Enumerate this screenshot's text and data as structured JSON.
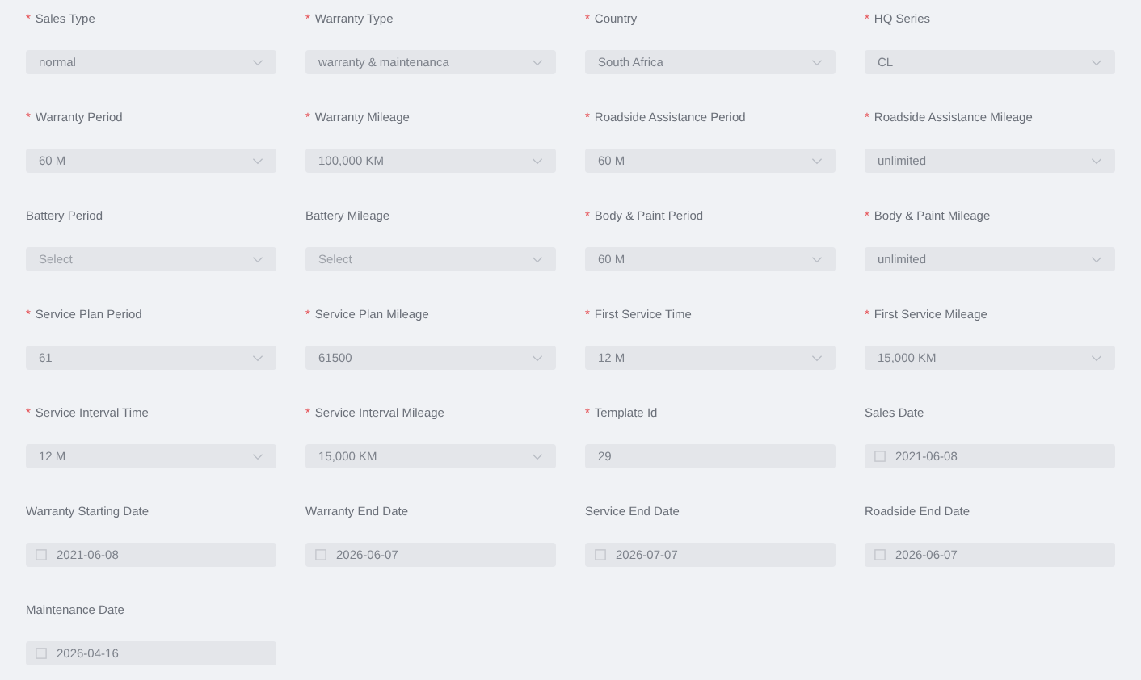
{
  "fields": [
    {
      "label": "Sales Type",
      "required_mark": "*",
      "kind": "select",
      "value": "normal"
    },
    {
      "label": "Warranty Type",
      "required_mark": "*",
      "kind": "select",
      "value": "warranty & maintenanca"
    },
    {
      "label": "Country",
      "required_mark": "*",
      "kind": "select",
      "value": "South Africa"
    },
    {
      "label": "HQ Series",
      "required_mark": "*",
      "kind": "select",
      "value": "CL"
    },
    {
      "label": "Warranty Period",
      "required_mark": "*",
      "kind": "select",
      "value": "60 M"
    },
    {
      "label": "Warranty Mileage",
      "required_mark": "*",
      "kind": "select",
      "value": "100,000 KM"
    },
    {
      "label": "Roadside Assistance Period",
      "required_mark": "*",
      "kind": "select",
      "value": "60 M"
    },
    {
      "label": "Roadside Assistance Mileage",
      "required_mark": "*",
      "kind": "select",
      "value": "unlimited"
    },
    {
      "label": "Battery Period",
      "kind": "select",
      "placeholder": "Select"
    },
    {
      "label": "Battery Mileage",
      "kind": "select",
      "placeholder": "Select"
    },
    {
      "label": "Body & Paint Period",
      "required_mark": "*",
      "kind": "select",
      "value": "60 M"
    },
    {
      "label": "Body & Paint Mileage",
      "required_mark": "*",
      "kind": "select",
      "value": "unlimited"
    },
    {
      "label": "Service Plan Period",
      "required_mark": "*",
      "kind": "select",
      "value": "61"
    },
    {
      "label": "Service Plan Mileage",
      "required_mark": "*",
      "kind": "select",
      "value": "61500"
    },
    {
      "label": "First Service Time",
      "required_mark": "*",
      "kind": "select",
      "value": "12 M"
    },
    {
      "label": "First Service Mileage",
      "required_mark": "*",
      "kind": "select",
      "value": "15,000 KM"
    },
    {
      "label": "Service Interval Time",
      "required_mark": "*",
      "kind": "select",
      "value": "12 M"
    },
    {
      "label": "Service Interval Mileage",
      "required_mark": "*",
      "kind": "select",
      "value": "15,000 KM"
    },
    {
      "label": "Template Id",
      "required_mark": "*",
      "kind": "input",
      "value": "29"
    },
    {
      "label": "Sales Date",
      "kind": "date",
      "value": "2021-06-08"
    },
    {
      "label": "Warranty Starting Date",
      "kind": "date",
      "value": "2021-06-08"
    },
    {
      "label": "Warranty End Date",
      "kind": "date",
      "value": "2026-06-07"
    },
    {
      "label": "Service End Date",
      "kind": "date",
      "value": "2026-07-07"
    },
    {
      "label": "Roadside End Date",
      "kind": "date",
      "value": "2026-06-07"
    },
    {
      "label": "Maintenance Date",
      "kind": "date",
      "value": "2026-04-16"
    }
  ]
}
